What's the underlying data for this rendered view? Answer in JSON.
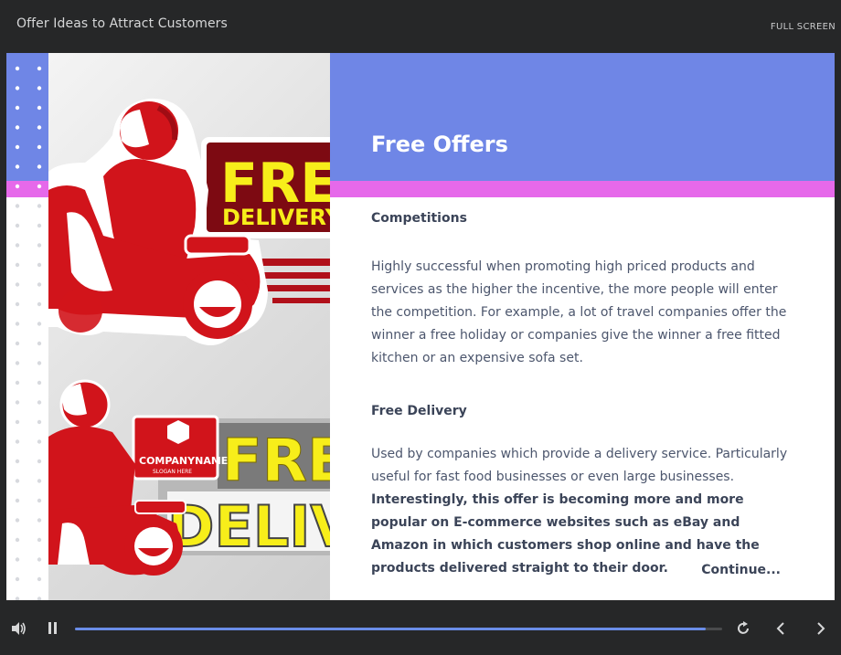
{
  "app": {
    "course_title": "Offer Ideas to Attract Customers",
    "fullscreen_label": "FULL SCREEN"
  },
  "slide": {
    "title": "Free Offers",
    "sections": [
      {
        "heading": "Competitions",
        "body": "Highly successful when promoting high priced products and services as the higher the incentive, the more people will enter the competition. For example, a lot of travel companies offer the winner a free holiday or companies give the winner a free fitted kitchen or an expensive sofa set."
      },
      {
        "heading": "Free Delivery",
        "body_plain": "Used by companies which provide a delivery service. Particularly useful for fast food businesses or even large businesses.",
        "body_bold": "Interestingly, this offer is becoming more and more popular on E-commerce websites such as eBay and Amazon in which customers shop online and have the products delivered straight to their door."
      }
    ],
    "continue_label": "Continue...",
    "image_text": {
      "top_sign_line1": "FREE",
      "top_sign_line2": "DELIVERY",
      "bottom_sign_line1": "FREE",
      "bottom_sign_line2": "DELIVERY",
      "company_name": "COMPANYNAME",
      "slogan": "SLOGAN HERE"
    }
  },
  "player": {
    "progress": 0.975,
    "icons": [
      "volume-icon",
      "pause-icon",
      "replay-icon",
      "prev-icon",
      "next-icon"
    ]
  },
  "colors": {
    "accent_blue": "#6f86e6",
    "accent_pink": "#e669ea",
    "scooter_red": "#d1141b",
    "sign_yellow": "#f7ee1a",
    "sign_dark_red": "#7d0a12"
  }
}
